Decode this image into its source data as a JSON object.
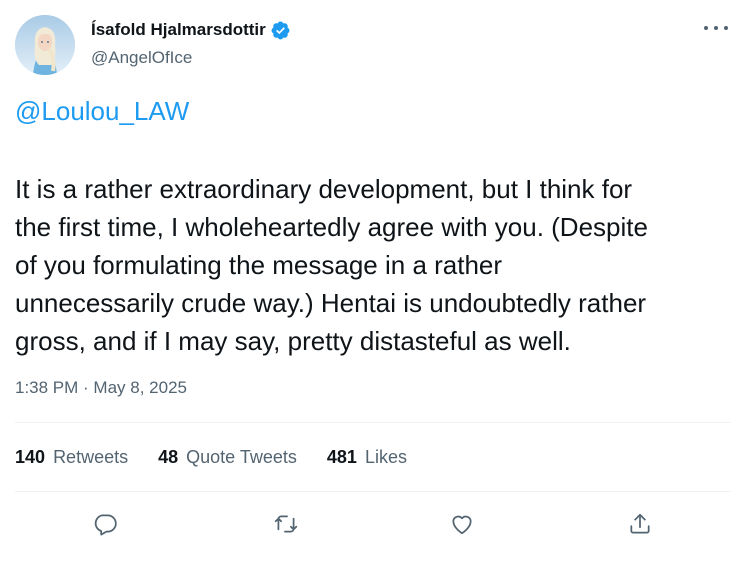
{
  "author": {
    "display_name": "Ísafold Hjalmarsdottir",
    "handle": "@AngelOfIce",
    "verified_icon": "verified-badge-icon",
    "avatar_icon": "avatar-image"
  },
  "tweet": {
    "reply_to": "@Loulou_LAW",
    "text": "It is a rather extraordinary development, but I think for\nthe first time, I wholeheartedly agree with you. (Despite\nof you formulating the message in a rather\nunnecessarily crude way.) Hentai is undoubtedly rather\ngross, and if I may say, pretty distasteful as well.",
    "timestamp": "1:38 PM · May 8, 2025"
  },
  "stats": {
    "retweets_count": "140",
    "retweets_label": "Retweets",
    "quotes_count": "48",
    "quotes_label": "Quote Tweets",
    "likes_count": "481",
    "likes_label": "Likes"
  },
  "actions": {
    "reply_icon": "reply-icon",
    "retweet_icon": "retweet-icon",
    "like_icon": "like-icon",
    "share_icon": "share-icon",
    "more_icon": "more-icon"
  },
  "colors": {
    "accent": "#1d9bf0",
    "text": "#0f1419",
    "secondary": "#536471",
    "divider": "#eff3f4"
  }
}
